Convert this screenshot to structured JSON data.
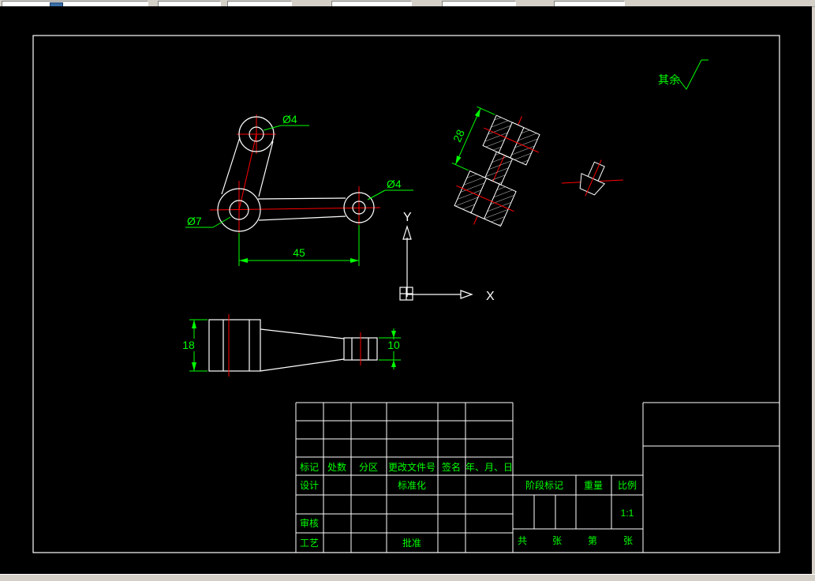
{
  "colors": {
    "background": "#000000",
    "outline": "#ffffff",
    "dimension_green": "#00ff00",
    "centerline_red": "#ff0000",
    "chrome_gray": "#d4d0c8"
  },
  "annotations": {
    "surface_note": "其余",
    "axis_x": "X",
    "axis_y": "Y"
  },
  "dimensions": {
    "top_hole_dia": "Ø4",
    "right_hole_dia": "Ø4",
    "center_hole_dia": "Ø7",
    "arm_length": "45",
    "iso_length": "28",
    "side_height": "18",
    "end_height": "10"
  },
  "title_block": {
    "header": [
      "标记",
      "处数",
      "分区",
      "更改文件号",
      "签名",
      "年、月、日"
    ],
    "design": "设计",
    "standardize": "标准化",
    "audit": "审核",
    "process": "工艺",
    "approve": "批准",
    "stage_mark": "阶段标记",
    "weight": "重量",
    "scale_label": "比例",
    "scale_value": "1:1",
    "sheet": [
      "共",
      "张",
      "第",
      "张"
    ]
  }
}
